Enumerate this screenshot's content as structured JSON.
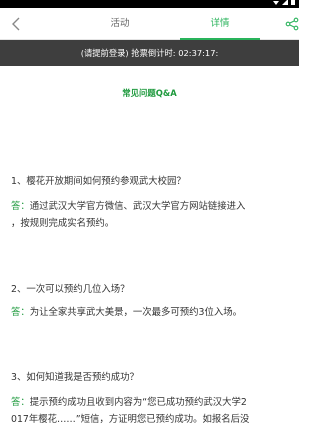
{
  "nav": {
    "tab_activity": "活动",
    "tab_detail": "详情"
  },
  "banner": {
    "text": "(请提前登录) 抢票倒计时: 02:37:17:"
  },
  "faq": {
    "title": "常见问题Q&A",
    "items": [
      {
        "question": "1、樱花开放期间如何预约参观武大校园？",
        "answer_label": "答：",
        "answer_lines": [
          "通过武汉大学官方微信、武汉大学官方网站链接进入",
          "，按规则完成实名预约。"
        ]
      },
      {
        "question": "2、一次可以预约几位入场？",
        "answer_label": "答：",
        "answer_lines": [
          "为让全家共享武大美景，一次最多可预约3位入场。"
        ]
      },
      {
        "question": "3、如何知道我是否预约成功？",
        "answer_label": "答：",
        "answer_lines": [
          "提示预约成功且收到内容为“您已成功预约武汉大学2",
          "017年樱花……”短信，方证明您已预约成功。如报名后没"
        ]
      }
    ]
  },
  "colors": {
    "accent_green": "#29b35b",
    "banner_bg": "#3e3e3e"
  },
  "icons": {
    "back": "chevron-left-icon",
    "share": "share-icon"
  }
}
